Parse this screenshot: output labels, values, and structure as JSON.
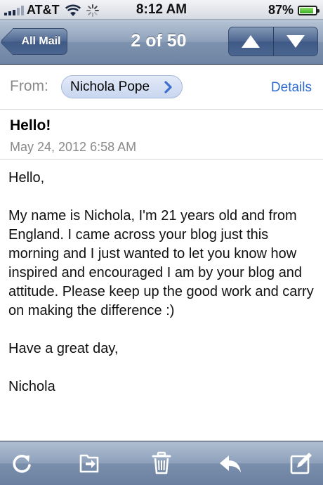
{
  "status_bar": {
    "carrier": "AT&T",
    "time": "8:12 AM",
    "battery_text": "87%",
    "battery_level": 0.87,
    "icons": [
      "signal-icon",
      "wifi-icon",
      "activity-icon",
      "battery-icon"
    ]
  },
  "nav": {
    "back_label": "All Mail",
    "title": "2 of 50",
    "prev_icon": "up-arrow-icon",
    "next_icon": "down-arrow-icon"
  },
  "header": {
    "from_label": "From:",
    "sender": "Nichola Pope",
    "details_label": "Details",
    "subject": "Hello!",
    "date": "May 24, 2012 6:58 AM"
  },
  "body": {
    "paragraphs": [
      "Hello,",
      "My name is Nichola, I'm 21 years old and from England. I came across your blog just this morning and I just wanted to let you know how inspired and encouraged I am by your blog and attitude. Please keep up the good work and carry on making the difference :)",
      "Have a great day,",
      "Nichola"
    ]
  },
  "toolbar": {
    "icons": [
      "refresh-icon",
      "move-folder-icon",
      "trash-icon",
      "reply-icon",
      "compose-icon"
    ]
  },
  "colors": {
    "nav_blue": "#6e84a3",
    "link_blue": "#2f6bd1",
    "muted_gray": "#8a8a8a"
  }
}
